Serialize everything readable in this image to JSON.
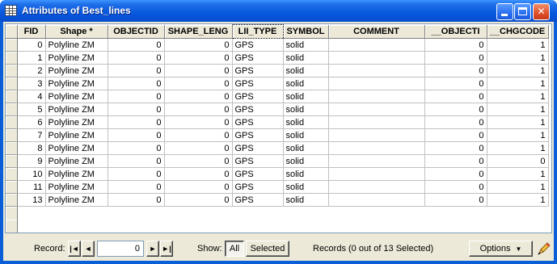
{
  "window": {
    "title": "Attributes of Best_lines",
    "minimize_label": "_",
    "maximize_label": "□",
    "close_label": "✕"
  },
  "table": {
    "columns": [
      "FID",
      "Shape *",
      "OBJECTID",
      "SHAPE_LENG",
      "LII_TYPE",
      "SYMBOL",
      "COMMENT",
      "__OBJECTI",
      "__CHGCODE"
    ],
    "rows": [
      [
        "0",
        "Polyline ZM",
        "0",
        "0",
        "GPS",
        "solid",
        "",
        "0",
        "1"
      ],
      [
        "1",
        "Polyline ZM",
        "0",
        "0",
        "GPS",
        "solid",
        "",
        "0",
        "1"
      ],
      [
        "2",
        "Polyline ZM",
        "0",
        "0",
        "GPS",
        "solid",
        "",
        "0",
        "1"
      ],
      [
        "3",
        "Polyline ZM",
        "0",
        "0",
        "GPS",
        "solid",
        "",
        "0",
        "1"
      ],
      [
        "4",
        "Polyline ZM",
        "0",
        "0",
        "GPS",
        "solid",
        "",
        "0",
        "1"
      ],
      [
        "5",
        "Polyline ZM",
        "0",
        "0",
        "GPS",
        "solid",
        "",
        "0",
        "1"
      ],
      [
        "6",
        "Polyline ZM",
        "0",
        "0",
        "GPS",
        "solid",
        "",
        "0",
        "1"
      ],
      [
        "7",
        "Polyline ZM",
        "0",
        "0",
        "GPS",
        "solid",
        "",
        "0",
        "1"
      ],
      [
        "8",
        "Polyline ZM",
        "0",
        "0",
        "GPS",
        "solid",
        "",
        "0",
        "1"
      ],
      [
        "9",
        "Polyline ZM",
        "0",
        "0",
        "GPS",
        "solid",
        "",
        "0",
        "0"
      ],
      [
        "10",
        "Polyline ZM",
        "0",
        "0",
        "GPS",
        "solid",
        "",
        "0",
        "1"
      ],
      [
        "11",
        "Polyline ZM",
        "0",
        "0",
        "GPS",
        "solid",
        "",
        "0",
        "1"
      ],
      [
        "13",
        "Polyline ZM",
        "0",
        "0",
        "GPS",
        "solid",
        "",
        "0",
        "1"
      ]
    ]
  },
  "footer": {
    "record_label": "Record:",
    "record_value": "0",
    "nav_first": "|◄",
    "nav_prev": "◄",
    "nav_next": "►",
    "nav_last": "►|",
    "show_label": "Show:",
    "all_label": "All",
    "selected_label": "Selected",
    "status": "Records (0 out of 13 Selected)",
    "options_label": "Options",
    "options_arrow": "▼"
  },
  "colors": {
    "titlebar": "#0a5adf",
    "frame": "#ece9d8"
  }
}
